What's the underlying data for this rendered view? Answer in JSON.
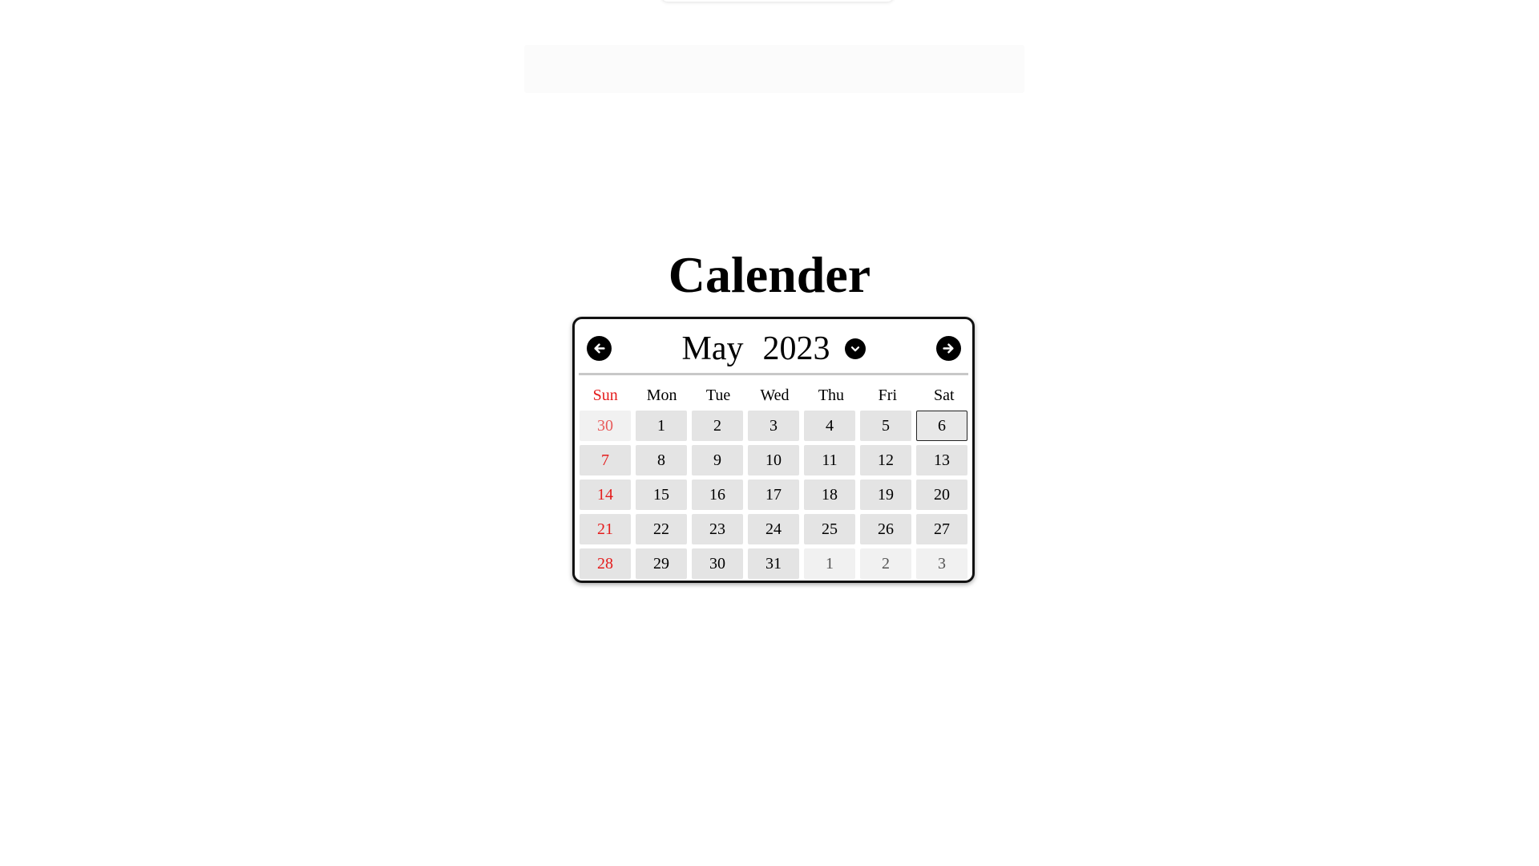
{
  "page": {
    "title": "Calender"
  },
  "calendar": {
    "month": "May",
    "year": "2023",
    "icons": {
      "prev": "arrow-left-icon",
      "next": "arrow-right-icon",
      "dropdown": "chevron-down-icon"
    },
    "weekdays": [
      "Sun",
      "Mon",
      "Tue",
      "Wed",
      "Thu",
      "Fri",
      "Sat"
    ],
    "weeks": [
      [
        {
          "d": "30",
          "other": true
        },
        {
          "d": "1"
        },
        {
          "d": "2"
        },
        {
          "d": "3"
        },
        {
          "d": "4"
        },
        {
          "d": "5"
        },
        {
          "d": "6",
          "today": true
        }
      ],
      [
        {
          "d": "7"
        },
        {
          "d": "8"
        },
        {
          "d": "9"
        },
        {
          "d": "10"
        },
        {
          "d": "11"
        },
        {
          "d": "12"
        },
        {
          "d": "13"
        }
      ],
      [
        {
          "d": "14"
        },
        {
          "d": "15"
        },
        {
          "d": "16"
        },
        {
          "d": "17"
        },
        {
          "d": "18"
        },
        {
          "d": "19"
        },
        {
          "d": "20"
        }
      ],
      [
        {
          "d": "21"
        },
        {
          "d": "22"
        },
        {
          "d": "23"
        },
        {
          "d": "24"
        },
        {
          "d": "25"
        },
        {
          "d": "26"
        },
        {
          "d": "27"
        }
      ],
      [
        {
          "d": "28"
        },
        {
          "d": "29"
        },
        {
          "d": "30"
        },
        {
          "d": "31"
        },
        {
          "d": "1",
          "other": true
        },
        {
          "d": "2",
          "other": true
        },
        {
          "d": "3",
          "other": true
        }
      ]
    ]
  },
  "colors": {
    "sunday": "#e41c1c",
    "day_bg": "#e4e4e4",
    "other_month_bg": "#f1f1f1"
  }
}
